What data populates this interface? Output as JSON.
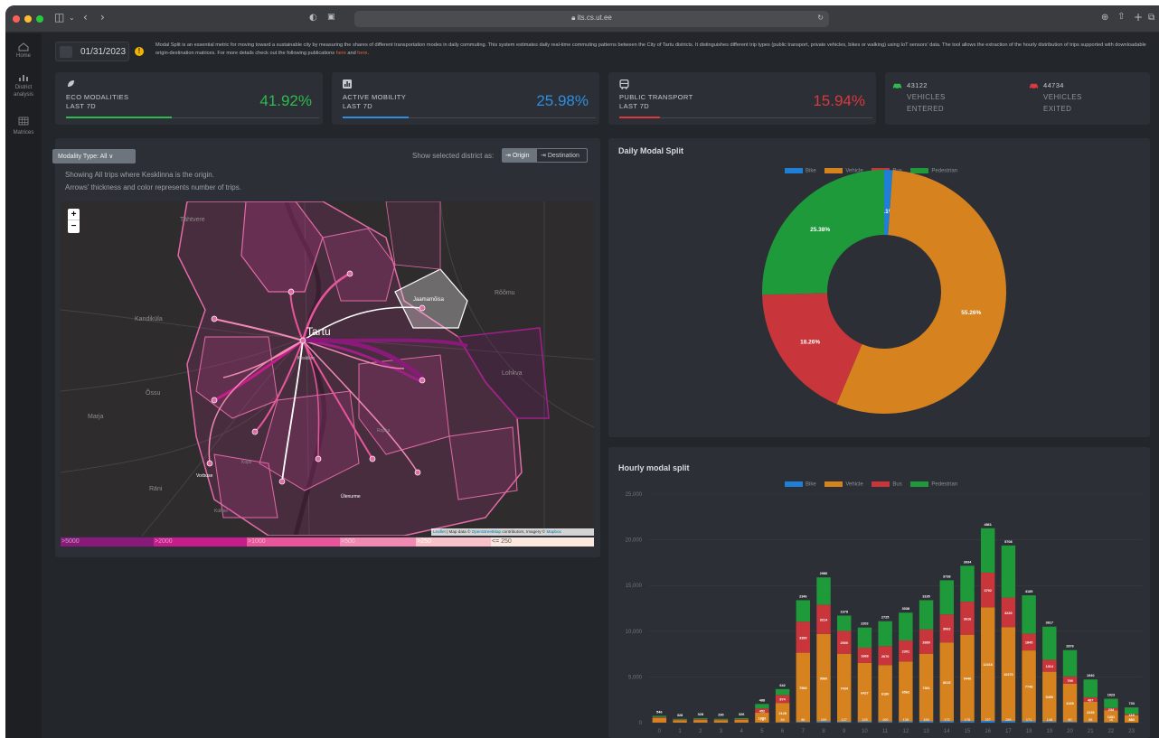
{
  "browser": {
    "url": "its.cs.ut.ee"
  },
  "sidebar": {
    "items": [
      {
        "label": "Home",
        "icon": "home-icon"
      },
      {
        "label": "District analysis",
        "icon": "bar-chart-icon"
      },
      {
        "label": "Matrices",
        "icon": "grid-icon"
      }
    ]
  },
  "header": {
    "date": "01/31/2023",
    "info_icon": "info-icon",
    "description": "Modal Split is an essential metric for moving toward a sustainable city by measuring the shares of different transportation modes in daily commuting. This system estimates daily real-time commuting patterns between the City of Tartu districts. It distinguishes different trip types (public transport, private vehicles, bikes or walking) using IoT sensors' data. The tool allows the extraction of the hourly distribution of trips supported with downloadable origin-destination matrices. For more details check out the following publications",
    "link_here_1": "here",
    "link_and": "and",
    "link_here_2": "here"
  },
  "kpis": [
    {
      "label_1": "ECO MODALITIES",
      "label_2": "LAST 7D",
      "value": "41.92%",
      "color": "#2dbb4f",
      "fill": 0.4192,
      "icon": "leaf-icon"
    },
    {
      "label_1": "ACTIVE MOBILITY",
      "label_2": "LAST 7D",
      "value": "25.98%",
      "color": "#2f8ee0",
      "fill": 0.2598,
      "icon": "bar-chart-icon"
    },
    {
      "label_1": "PUBLIC TRANSPORT",
      "label_2": "LAST 7D",
      "value": "15.94%",
      "color": "#d9393f",
      "fill": 0.1594,
      "icon": "bus-icon"
    }
  ],
  "vehicles": {
    "entered_count": "43122",
    "entered_label": "VEHICLES",
    "entered_sub": "ENTERED",
    "exited_count": "44734",
    "exited_label": "VEHICLES",
    "exited_sub": "EXITED"
  },
  "map_panel": {
    "modality_button": "Modality Type: All ∨",
    "show_as_label": "Show selected district as:",
    "origin_button": "Origin",
    "destination_button": "Destination",
    "caption_1": "Showing All trips where Kesklinna is the origin.",
    "caption_2": "Arrows' thickness and color represents number of trips.",
    "zoom_in": "+",
    "zoom_out": "−",
    "attribution_leaflet": "Leaflet",
    "attribution_text": "| Map data ©",
    "attribution_osm": "OpenStreetMap",
    "attribution_mid": "contributors, Imagery ©",
    "attribution_mapbox": "Mapbox",
    "city_label": "Tartu",
    "place_labels": [
      "Tähtvere",
      "Rõõmu",
      "Jaamamõisa",
      "Kandiküla",
      "Lohkva",
      "Õssu",
      "Marja",
      "Räni",
      "Ülenurme",
      "Vorbuse",
      "Külitse",
      "Ropka",
      "Kopli",
      "Kesklinn"
    ],
    "legend": [
      {
        "label": ">5000",
        "color": "#8a1a7a"
      },
      {
        "label": ">2000",
        "color": "#c61c8c"
      },
      {
        "label": ">1000",
        "color": "#e8559b"
      },
      {
        "label": ">500",
        "color": "#f08ab2"
      },
      {
        "label": ">250",
        "color": "#f8c2c8"
      },
      {
        "label": "<= 250",
        "color": "#fde8df"
      }
    ]
  },
  "colors": {
    "bike": "#1f7fd6",
    "vehicle": "#d6821f",
    "bus": "#c8363c",
    "pedestrian": "#1f9a3a"
  },
  "chart_data": [
    {
      "type": "pie",
      "title": "Daily Modal Split",
      "legend": [
        "Bike",
        "Vehicle",
        "Bus",
        "Pedestrian"
      ],
      "values": [
        1.1,
        55.26,
        18.26,
        25.38
      ],
      "labels": [
        "1.1%",
        "55.26%",
        "18.26%",
        "25.38%"
      ],
      "legend_position": "top"
    },
    {
      "type": "bar",
      "title": "Hourly modal split",
      "legend": [
        "Bike",
        "Vehicle",
        "Bus",
        "Pedestrian"
      ],
      "legend_position": "top",
      "stacked": true,
      "categories": [
        "0",
        "1",
        "2",
        "3",
        "4",
        "5",
        "6",
        "7",
        "8",
        "9",
        "10",
        "11",
        "12",
        "13",
        "14",
        "15",
        "16",
        "17",
        "18",
        "19",
        "20",
        "21",
        "22",
        "23"
      ],
      "ylim": [
        0,
        25000
      ],
      "yticks": [
        "0",
        "5,000",
        "10,000",
        "15,000",
        "20,000",
        "25,000"
      ],
      "series": [
        {
          "name": "Bike",
          "values": [
            2,
            1,
            1,
            1,
            2,
            10,
            30,
            80,
            130,
            100,
            110,
            120,
            130,
            150,
            160,
            170,
            200,
            180,
            150,
            120,
            90,
            60,
            30,
            10
          ]
        },
        {
          "name": "Vehicle",
          "values": [
            505,
            255,
            290,
            250,
            295,
            1093,
            2128,
            7568,
            9560,
            7434,
            6427,
            6180,
            6562,
            7361,
            8615,
            9446,
            12416,
            10273,
            7748,
            5450,
            4169,
            2235,
            1331,
            803
          ]
        },
        {
          "name": "Bus",
          "values": [
            100,
            70,
            80,
            70,
            80,
            452,
            874,
            3399,
            3214,
            2500,
            1668,
            2070,
            2301,
            2689,
            3062,
            3616,
            3792,
            3220,
            1845,
            1314,
            799,
            487,
            234,
            119
          ]
        },
        {
          "name": "Pedestrian",
          "values": [
            140,
            90,
            110,
            100,
            116,
            488,
            642,
            2346,
            2986,
            1678,
            2202,
            2725,
            3038,
            3195,
            3738,
            3934,
            4861,
            5708,
            4185,
            3617,
            2876,
            1940,
            1023,
            733
          ]
        }
      ],
      "segment_labels": {
        "vehicle": [
          "",
          "",
          "",
          "",
          "",
          "1093",
          "2128",
          "7568",
          "9560",
          "7434",
          "6427",
          "6180",
          "6562",
          "7361",
          "8615",
          "9446",
          "12416",
          "10273",
          "7748",
          "5450",
          "4169",
          "2235",
          "1331",
          "803"
        ],
        "bus": [
          "",
          "",
          "",
          "",
          "",
          "452",
          "874",
          "3399",
          "3214",
          "2500",
          "1668",
          "2070",
          "2301",
          "2689",
          "3062",
          "3616",
          "3792",
          "3220",
          "1845",
          "1314",
          "799",
          "487",
          "234",
          "119"
        ],
        "pedestrian": [
          "546",
          "328",
          "328",
          "290",
          "326",
          "488",
          "642",
          "2346",
          "2986",
          "1678",
          "2202",
          "2725",
          "3038",
          "3195",
          "3738",
          "3934",
          "4861",
          "5708",
          "4185",
          "3617",
          "2876",
          "1940",
          "1023",
          "733"
        ],
        "bottom": [
          "",
          "",
          "",
          "",
          "",
          "78",
          "84",
          "86",
          "100",
          "127",
          "125",
          "100",
          "135",
          "150",
          "173",
          "178",
          "227",
          "289",
          "171",
          "148",
          "80",
          "58",
          "16",
          "8"
        ]
      }
    }
  ]
}
